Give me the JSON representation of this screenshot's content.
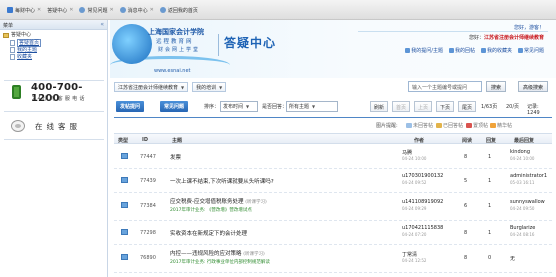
{
  "browser_tabs": [
    {
      "label": "每财中心",
      "closable": true
    },
    {
      "label": "答疑中心",
      "closable": true
    },
    {
      "label": "常见问题",
      "closable": true
    },
    {
      "label": "消息中心",
      "closable": true
    },
    {
      "label": "返回我的首页",
      "closable": false
    }
  ],
  "sidebar": {
    "header": "菜单",
    "collapse_glyph": "«",
    "root": "答疑中心",
    "items": [
      "答疑首页",
      "我的主题",
      "收藏夹"
    ],
    "phone": "400-700-1200",
    "phone_sub": "24小时客服电话",
    "service": "在线客服"
  },
  "banner": {
    "org_line1": "上海国家会计学院",
    "org_line2": "远程教育网",
    "org_line3": "财会网上学堂",
    "org_url": "www.esnai.net",
    "title": "答疑中心",
    "hello": "您好，游客！",
    "user_prefix": "您好：",
    "user_highlight": "江苏省注册会计师继续教育",
    "links": [
      "我的提问/主题",
      "我的回帖",
      "我的收藏夹",
      "常见问题"
    ]
  },
  "crumbs": [
    "江苏省注册会计师继续教育",
    "我的培训"
  ],
  "search": {
    "placeholder": "输入一个主题编号或提问",
    "search_label": "搜索",
    "advanced_label": "高级搜索"
  },
  "toolbar": {
    "ask_label": "发帖提问",
    "faq_label": "常见问题",
    "sort_label": "排序：",
    "sort_value": "发布时间",
    "answered_label": "是否回答：",
    "answered_value": "所有主题",
    "refresh": "刷新",
    "first": "首页",
    "prev": "上页",
    "next": "下页",
    "last": "尾页",
    "page_info": "1/63页",
    "per_page": "20/页",
    "records": "记录: 1249"
  },
  "legend": {
    "title": "图片提醒:",
    "items": [
      "未回答帖",
      "已回答帖",
      "置顶帖",
      "精华帖"
    ]
  },
  "table": {
    "headers": [
      "类型",
      "ID",
      "主题",
      "作者",
      "阅读",
      "回复",
      "最后回复"
    ],
    "rows": [
      {
        "id": "77447",
        "subject": "发票",
        "tag": "",
        "sub": "",
        "author": "马腾",
        "author_date": "04-24 10:00",
        "views": "8",
        "replies": "1",
        "last": "kindong",
        "last_date": "04-24 10:00"
      },
      {
        "id": "77439",
        "subject": "一次上课不结束,下次听课就要从头听课吗?",
        "tag": "",
        "sub": "",
        "author": "u170301900132",
        "author_date": "04-24 09:52",
        "views": "5",
        "replies": "1",
        "last": "administrator1",
        "last_date": "05-03 16:11"
      },
      {
        "id": "77384",
        "subject": "应交税费-应交增值税账务处理",
        "tag": "(听课学习)",
        "sub": "2017年审计业务: 《营改增》营改增试点",
        "author": "u141108919092",
        "author_date": "04-24 09:29",
        "views": "6",
        "replies": "1",
        "last": "sunnyswallow",
        "last_date": "04-24 09:50"
      },
      {
        "id": "77298",
        "subject": "实收资本在新规定下的会计处理",
        "tag": "",
        "sub": "",
        "author": "u170421115838",
        "author_date": "04-24 07:20",
        "views": "8",
        "replies": "1",
        "last": "Burglarize",
        "last_date": "04-24 08:16"
      },
      {
        "id": "76890",
        "subject": "内控——违规风险的应对策略",
        "tag": "(听课学习)",
        "sub": "2017年审计业务: 行政事业单位内部控制规范解读",
        "author": "丁常清",
        "author_date": "04-24 12:52",
        "views": "8",
        "replies": "0",
        "last": "无",
        "last_date": ""
      }
    ]
  },
  "colors": {
    "accent": "#1e63b5",
    "button": "#2f73c4",
    "highlight": "#c8171c"
  }
}
